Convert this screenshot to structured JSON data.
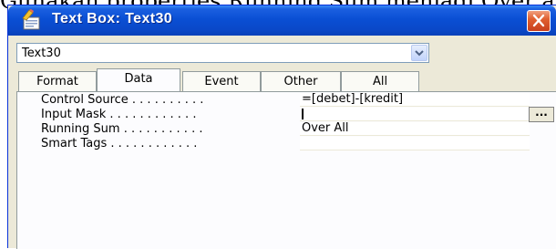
{
  "background_text": "Gunakan properties Running Sum menjadi Over all",
  "window": {
    "title": "Text Box: Text30",
    "title_icon": "properties-sheet-icon",
    "close_icon": "close-icon"
  },
  "combo": {
    "selected": "Text30",
    "dropdown_icon": "chevron-down-icon"
  },
  "tabs": [
    {
      "label": "Format",
      "active": false
    },
    {
      "label": "Data",
      "active": true
    },
    {
      "label": "Event",
      "active": false
    },
    {
      "label": "Other",
      "active": false
    },
    {
      "label": "All",
      "active": false
    }
  ],
  "properties": [
    {
      "label": "Control Source . . . . . . . . . .",
      "value": "=[debet]-[kredit]"
    },
    {
      "label": "Input Mask . . . . . . . . . . . .",
      "value": ""
    },
    {
      "label": "Running Sum . . . . . . . . . . .",
      "value": "Over All"
    },
    {
      "label": "Smart Tags . . . . . . . . . . . .",
      "value": ""
    }
  ],
  "builder_button": {
    "label": "...",
    "icon": "ellipsis-icon"
  },
  "colors": {
    "title_bar": "#0a4fd4",
    "close_button": "#e06030",
    "window_bg": "#ece9d8",
    "panel_bg": "#fcfcfe"
  }
}
